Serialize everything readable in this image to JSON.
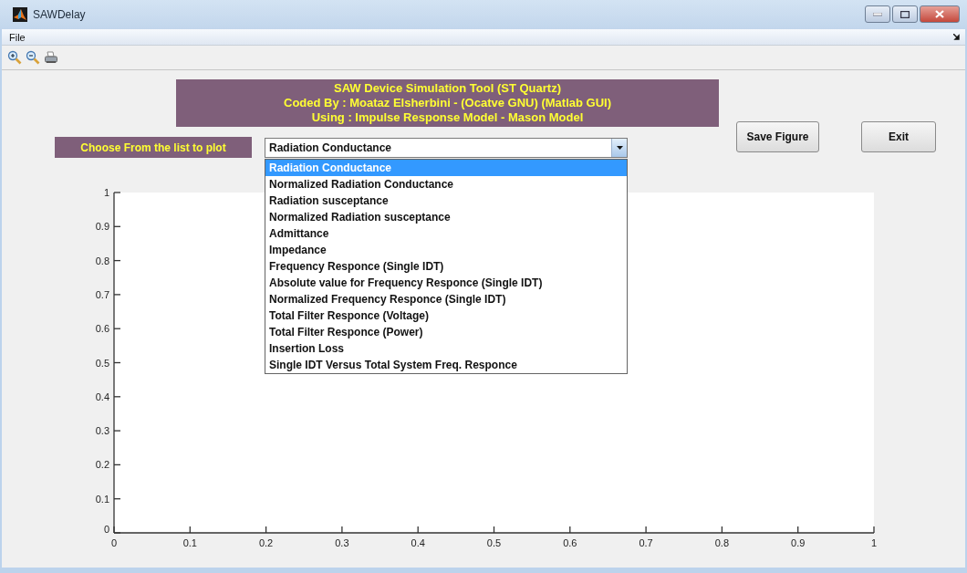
{
  "window": {
    "title": "SAWDelay"
  },
  "menu": [
    "File"
  ],
  "header": {
    "lines": [
      "SAW Device Simulation Tool (ST Quartz)",
      "Coded By : Moataz Elsherbini - (Ocatve GNU) (Matlab GUI)",
      "Using : Impulse Response Model - Mason Model"
    ]
  },
  "plot_label": "Choose From the list to plot",
  "plot_select": {
    "value": "Radiation Conductance",
    "expanded": true,
    "options": [
      {
        "label": "Radiation Conductance",
        "selected": true
      },
      {
        "label": "Normalized Radiation Conductance",
        "selected": false
      },
      {
        "label": "Radiation susceptance",
        "selected": false
      },
      {
        "label": "Normalized Radiation susceptance",
        "selected": false
      },
      {
        "label": "Admittance",
        "selected": false
      },
      {
        "label": "Impedance",
        "selected": false
      },
      {
        "label": "Frequency Responce (Single IDT)",
        "selected": false
      },
      {
        "label": "Absolute value for Frequency Responce (Single IDT)",
        "selected": false
      },
      {
        "label": "Normalized Frequency Responce (Single IDT)",
        "selected": false
      },
      {
        "label": "Total Filter Responce (Voltage)",
        "selected": false
      },
      {
        "label": "Total Filter Responce (Power)",
        "selected": false
      },
      {
        "label": "Insertion Loss",
        "selected": false
      },
      {
        "label": "Single IDT Versus Total System Freq. Responce",
        "selected": false
      }
    ]
  },
  "buttons": [
    "Save Figure",
    "Exit"
  ],
  "axes": {
    "chart_data": {
      "type": "line",
      "xlim": [
        0,
        1
      ],
      "ylim": [
        0,
        1
      ],
      "xticks": [
        0,
        0.1,
        0.2,
        0.3,
        0.4,
        0.5,
        0.6,
        0.7,
        0.8,
        0.9,
        1
      ],
      "yticks": [
        0,
        0.1,
        0.2,
        0.3,
        0.4,
        0.5,
        0.6,
        0.7,
        0.8,
        0.9,
        1
      ]
    }
  }
}
